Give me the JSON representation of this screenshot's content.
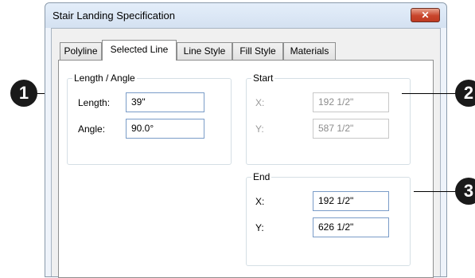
{
  "window": {
    "title": "Stair Landing Specification",
    "close_label": "✕"
  },
  "tabs": [
    {
      "label": "Polyline"
    },
    {
      "label": "Selected Line"
    },
    {
      "label": "Line Style"
    },
    {
      "label": "Fill Style"
    },
    {
      "label": "Materials"
    }
  ],
  "length_angle": {
    "legend": "Length / Angle",
    "length_label": "Length:",
    "length_value": "39\"",
    "angle_label": "Angle:",
    "angle_value": "90.0°"
  },
  "start": {
    "legend": "Start",
    "x_label": "X:",
    "x_value": "192 1/2\"",
    "y_label": "Y:",
    "y_value": "587 1/2\""
  },
  "end": {
    "legend": "End",
    "x_label": "X:",
    "x_value": "192 1/2\"",
    "y_label": "Y:",
    "y_value": "626 1/2\""
  },
  "callouts": [
    "1",
    "2",
    "3"
  ]
}
